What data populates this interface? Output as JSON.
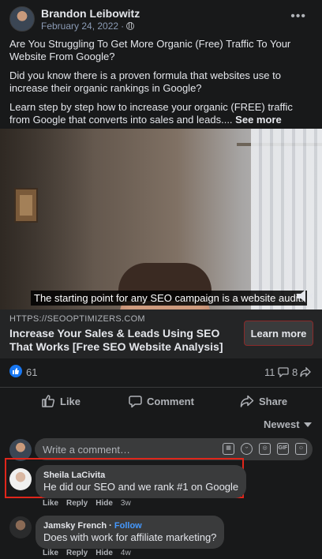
{
  "post": {
    "author": "Brandon Leibowitz",
    "date": "February 24, 2022",
    "paragraphs": [
      "Are You Struggling To Get More Organic (Free) Traffic To Your Website From Google?",
      "Did you know there is a proven formula that websites use to increase their organic rankings in Google?"
    ],
    "last_paragraph": "Learn step by step how to increase your organic (FREE) traffic from Google that converts into sales and leads....",
    "see_more": "See more"
  },
  "video": {
    "caption": "The starting point for any SEO campaign is a website audit."
  },
  "link_preview": {
    "domain": "HTTPS://SEOOPTIMIZERS.COM",
    "title": "Increase Your Sales & Leads Using SEO That Works [Free SEO Website Analysis]",
    "cta": "Learn more"
  },
  "stats": {
    "reactions": "61",
    "comments": "11",
    "shares": "8"
  },
  "actions": {
    "like": "Like",
    "comment": "Comment",
    "share": "Share"
  },
  "sort": {
    "selected": "Newest"
  },
  "composer": {
    "placeholder": "Write a comment…",
    "icons": [
      "sticker-icon",
      "emoji-icon",
      "camera-icon",
      "gif-icon",
      "sticker-face-icon"
    ]
  },
  "comments": [
    {
      "author": "Sheila LaCivita",
      "text": "He did our SEO and we rank #1 on Google",
      "like": "Like",
      "reply": "Reply",
      "hide": "Hide",
      "time": "3w"
    },
    {
      "author": "Jamsky French",
      "follow": "Follow",
      "text": "Does with work for affiliate marketing?",
      "like": "Like",
      "reply": "Reply",
      "hide": "Hide",
      "time": "4w"
    }
  ],
  "colors": {
    "background": "#18191a",
    "accent_blue": "#1877f2",
    "highlight_red": "#e0261b"
  }
}
